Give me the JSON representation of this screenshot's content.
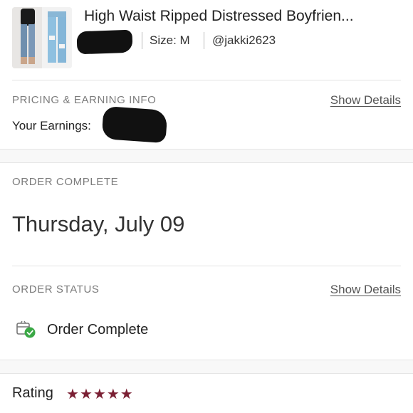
{
  "product": {
    "title": "High Waist Ripped Distressed Boyfrien...",
    "size": "Size: M",
    "seller": "@jakki2623"
  },
  "pricing": {
    "section_label": "PRICING & EARNING INFO",
    "details_link": "Show Details",
    "earnings_label": "Your Earnings:",
    "earnings_visible_prefix": "$"
  },
  "order": {
    "section_label": "ORDER COMPLETE",
    "date": "Thursday, July 09"
  },
  "status": {
    "section_label": "ORDER STATUS",
    "details_link": "Show Details",
    "icon": "box-check-icon",
    "text": "Order Complete"
  },
  "rating": {
    "label": "Rating",
    "stars": 5,
    "star_color": "#7a1f33"
  },
  "colors": {
    "accent_check": "#3aa845",
    "text_muted": "#7c7c7c"
  }
}
